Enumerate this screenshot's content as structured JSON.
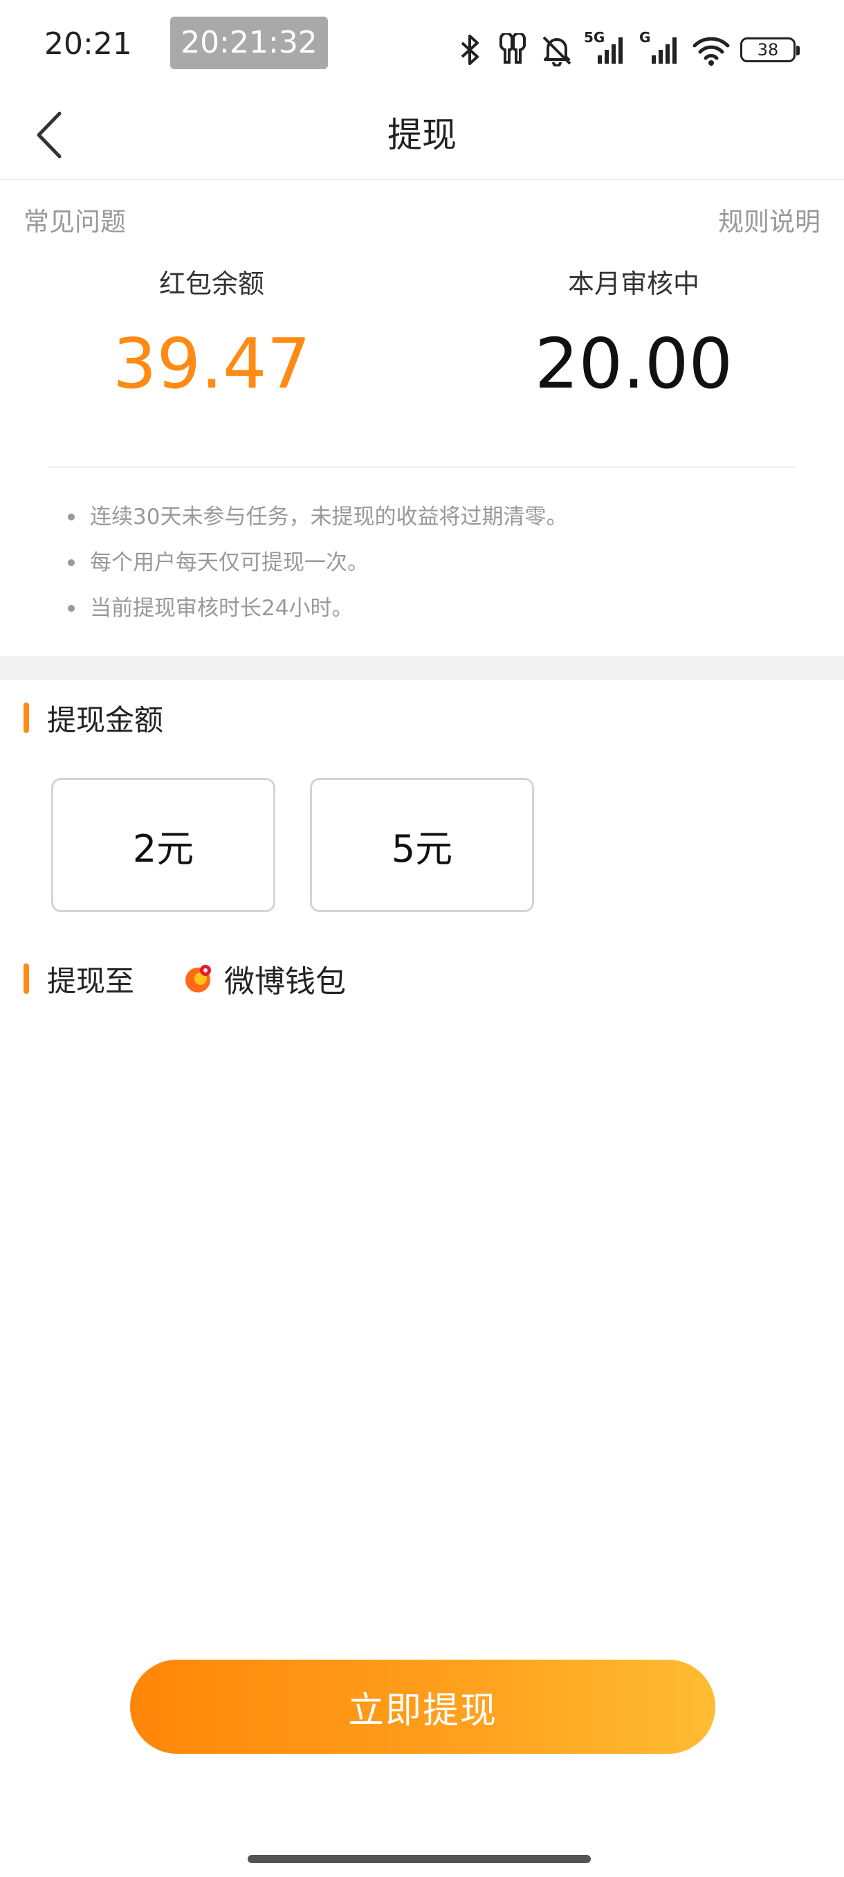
{
  "status_bar": {
    "time": "20:21",
    "clock_overlay": "20:21:32",
    "network_1": "5G",
    "network_2": "G",
    "battery": "38"
  },
  "nav": {
    "title": "提现"
  },
  "links": {
    "faq": "常见问题",
    "rules": "规则说明"
  },
  "balances": {
    "red_packet_label": "红包余额",
    "red_packet_value": "39.47",
    "reviewing_label": "本月审核中",
    "reviewing_value": "20.00"
  },
  "notes": [
    "连续30天未参与任务，未提现的收益将过期清零。",
    "每个用户每天仅可提现一次。",
    "当前提现审核时长24小时。"
  ],
  "withdraw_amount": {
    "title": "提现金额",
    "options": [
      "2元",
      "5元"
    ]
  },
  "withdraw_to": {
    "title": "提现至",
    "wallet_name": "微博钱包"
  },
  "cta": {
    "label": "立即提现"
  },
  "colors": {
    "accent": "#ff8a14",
    "cta_start": "#ff8608",
    "cta_end": "#ffbc32"
  }
}
